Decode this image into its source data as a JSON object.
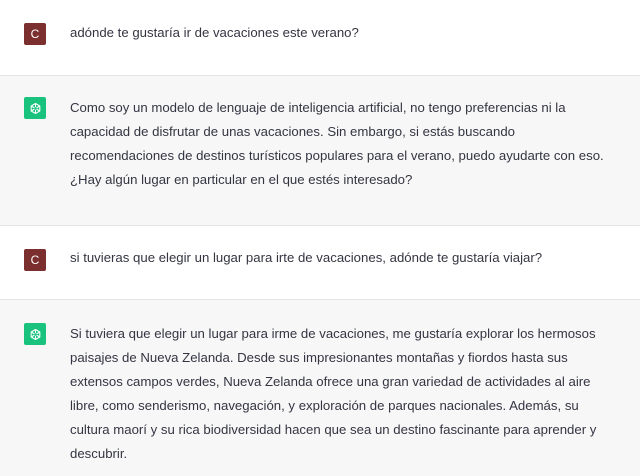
{
  "messages": [
    {
      "role": "user",
      "avatar_letter": "C",
      "text": "adónde te gustaría ir de vacaciones este verano?"
    },
    {
      "role": "assistant",
      "avatar_icon": "chatgpt-logo-icon",
      "text": "Como soy un modelo de lenguaje de inteligencia artificial, no tengo preferencias ni la\ncapacidad de disfrutar de unas vacaciones. Sin embargo, si estás buscando\nrecomendaciones de destinos turísticos populares para el verano, puedo ayudarte con eso.\n¿Hay algún lugar en particular en el que estés interesado?"
    },
    {
      "role": "user",
      "avatar_letter": "C",
      "text": "si tuvieras que elegir un lugar para irte de vacaciones, adónde te gustaría viajar?"
    },
    {
      "role": "assistant",
      "avatar_icon": "chatgpt-logo-icon",
      "text": "Si tuviera que elegir un lugar para irme de vacaciones, me gustaría explorar los hermosos\npaisajes de Nueva Zelanda. Desde sus impresionantes montañas y fiordos hasta sus\nextensos campos verdes, Nueva Zelanda ofrece una gran variedad de actividades al aire\nlibre, como senderismo, navegación, y exploración de parques nacionales. Además, su\ncultura maorí y su rica biodiversidad hacen que sea un destino fascinante para aprender y\ndescubrir."
    }
  ],
  "colors": {
    "user_avatar": "#7c2f2f",
    "bot_avatar": "#19c37d",
    "bot_background": "#f7f7f8",
    "text": "#343541"
  }
}
